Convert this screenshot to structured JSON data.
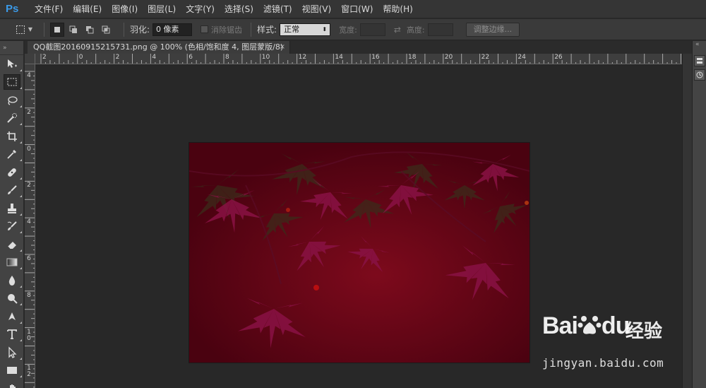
{
  "app": {
    "logo": "Ps"
  },
  "menu": [
    "文件(F)",
    "编辑(E)",
    "图像(I)",
    "图层(L)",
    "文字(Y)",
    "选择(S)",
    "滤镜(T)",
    "视图(V)",
    "窗口(W)",
    "帮助(H)"
  ],
  "options": {
    "feather_label": "羽化:",
    "feather_value": "0 像素",
    "antialias_label": "消除锯齿",
    "style_label": "样式:",
    "style_value": "正常",
    "width_label": "宽度:",
    "height_label": "高度:",
    "refine_label": "调整边缘..."
  },
  "document": {
    "tab_title": "QQ截图20160915215731.png @ 100% (色相/饱和度 4, 图层蒙版/8) *",
    "close": "×"
  },
  "ruler_top": [
    "2",
    "0",
    "2",
    "4",
    "6",
    "8",
    "10",
    "12",
    "14",
    "16",
    "18",
    "20",
    "22",
    "24",
    "26"
  ],
  "ruler_left": [
    "4",
    "2",
    "0",
    "2",
    "4",
    "6",
    "8",
    "1\n0",
    "1\n2"
  ],
  "watermark": {
    "brand": "Bai",
    "brand2": "du",
    "cn": "经验",
    "url": "jingyan.baidu.com"
  },
  "colors": {
    "image_base": "#5e0312",
    "leaf": "#8a1245",
    "leaf_dark": "#3a2a1a",
    "accent": "#3b9ae8"
  }
}
